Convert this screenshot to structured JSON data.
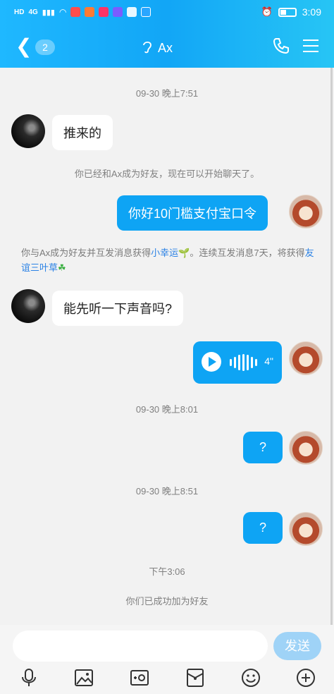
{
  "status_bar": {
    "time": "3:09",
    "hd": "HD",
    "net": "4G"
  },
  "header": {
    "back_badge": "2",
    "title": "Ax"
  },
  "messages": {
    "ts1": "09-30 晚上7:51",
    "in1": "推来的",
    "sys1": "你已经和Ax成为好友，现在可以开始聊天了。",
    "out1": "你好10门槛支付宝口令",
    "friend_note": {
      "part1": "你与Ax成为好友并互发消息获得",
      "link1": "小幸运",
      "part2": "。连续互发消息7天，将获得",
      "link2": "友谊三叶草"
    },
    "in2": "能先听一下声音吗?",
    "voice_duration": "4\"",
    "ts2": "09-30 晚上8:01",
    "out2": "?",
    "ts3": "09-30 晚上8:51",
    "out3": "?",
    "ts4": "下午3:06",
    "sys2": "你们已成功加为好友"
  },
  "input": {
    "send_label": "发送",
    "placeholder": ""
  },
  "colors": {
    "accent": "#0ea4f4",
    "header_start": "#1fb8ff",
    "header_end": "#27c5f5"
  }
}
